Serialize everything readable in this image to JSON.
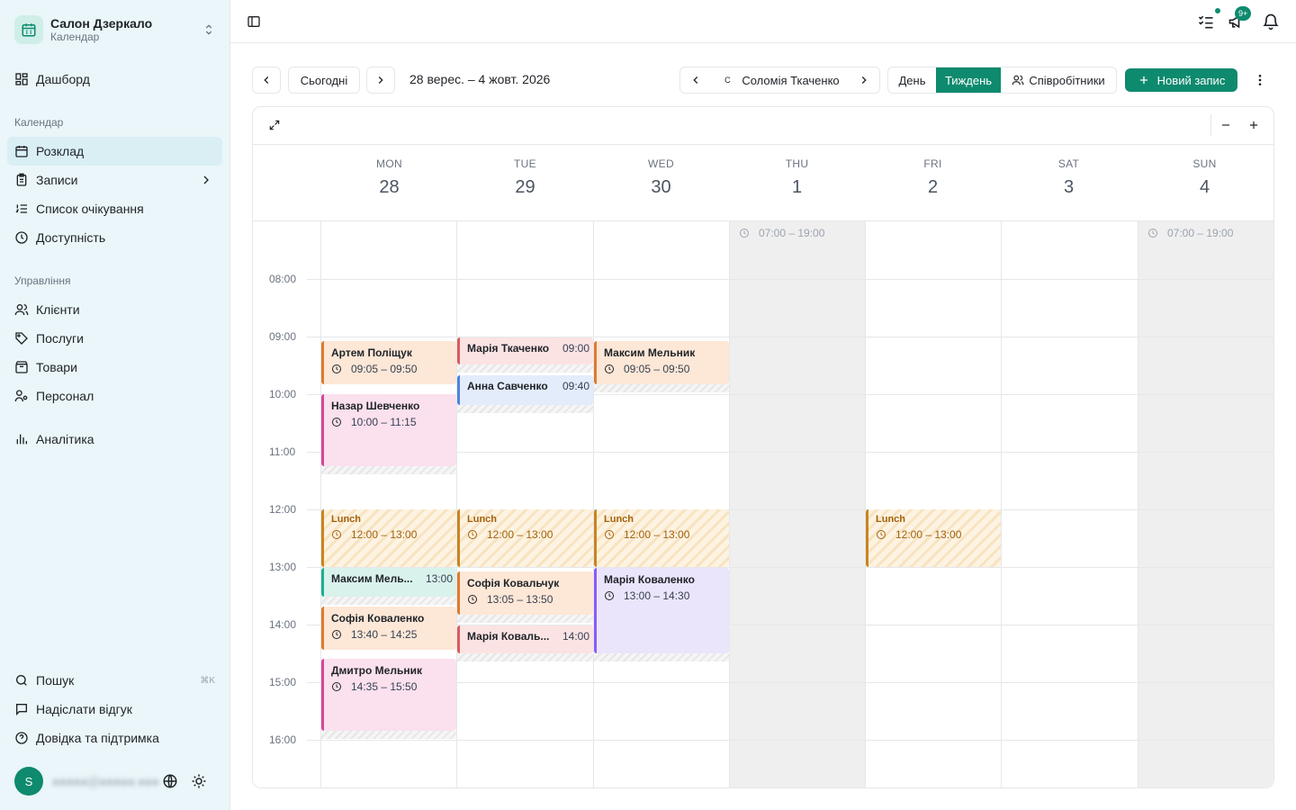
{
  "sidebar": {
    "brand_title": "Салон Дзеркало",
    "brand_sub": "Календар",
    "dashboard": "Дашборд",
    "section_calendar": "Календар",
    "schedule": "Розклад",
    "appointments": "Записи",
    "waitlist": "Список очікування",
    "availability": "Доступність",
    "section_management": "Управління",
    "clients": "Клієнти",
    "services": "Послуги",
    "products": "Товари",
    "staff": "Персонал",
    "analytics": "Аналітика",
    "search": "Пошук",
    "search_kbd": "⌘K",
    "feedback": "Надіслати відгук",
    "help": "Довідка та підтримка",
    "avatar_initial": "S",
    "user_email": "●●●●●@●●●●●.●●●"
  },
  "topbar": {
    "badge_count": "9+"
  },
  "toolbar": {
    "today": "Сьогодні",
    "date_range": "28 верес. – 4 жовт. 2026",
    "staff_initial": "С",
    "staff_name": "Соломія Ткаченко",
    "view_day": "День",
    "view_week": "Тиждень",
    "view_staff": "Співробітники",
    "new_appointment": "Новий запис"
  },
  "days": [
    {
      "dow": "MON",
      "num": "28"
    },
    {
      "dow": "TUE",
      "num": "29"
    },
    {
      "dow": "WED",
      "num": "30"
    },
    {
      "dow": "THU",
      "num": "1"
    },
    {
      "dow": "FRI",
      "num": "2"
    },
    {
      "dow": "SAT",
      "num": "3"
    },
    {
      "dow": "SUN",
      "num": "4"
    }
  ],
  "hours": [
    "08:00",
    "09:00",
    "10:00",
    "11:00",
    "12:00",
    "13:00",
    "14:00",
    "15:00",
    "16:00"
  ],
  "availability": [
    "07:00 – 19:00",
    "07:00 – 19:00"
  ],
  "events": {
    "mon1": {
      "name": "Артем Поліщук",
      "time": "09:05 – 09:50"
    },
    "mon2": {
      "name": "Назар Шевченко",
      "time": "10:00 – 11:15"
    },
    "mon3": {
      "name": "Максим Мель...",
      "time": "13:00"
    },
    "mon4": {
      "name": "Софія Коваленко",
      "time": "13:40 – 14:25"
    },
    "mon5": {
      "name": "Дмитро Мельник",
      "time": "14:35 – 15:50"
    },
    "tue1": {
      "name": "Марія Ткаченко",
      "time": "09:00"
    },
    "tue2": {
      "name": "Анна Савченко",
      "time": "09:40"
    },
    "tue3": {
      "name": "Софія Ковальчук",
      "time": "13:05 – 13:50"
    },
    "tue4": {
      "name": "Марія Коваль...",
      "time": "14:00"
    },
    "wed1": {
      "name": "Максим Мельник",
      "time": "09:05 – 09:50"
    },
    "wed2": {
      "name": "Марія Коваленко",
      "time": "13:00 – 14:30"
    },
    "lunch": {
      "name": "Lunch",
      "time": "12:00 – 13:00"
    }
  },
  "colors": {
    "accent": "#0e8a6e"
  }
}
